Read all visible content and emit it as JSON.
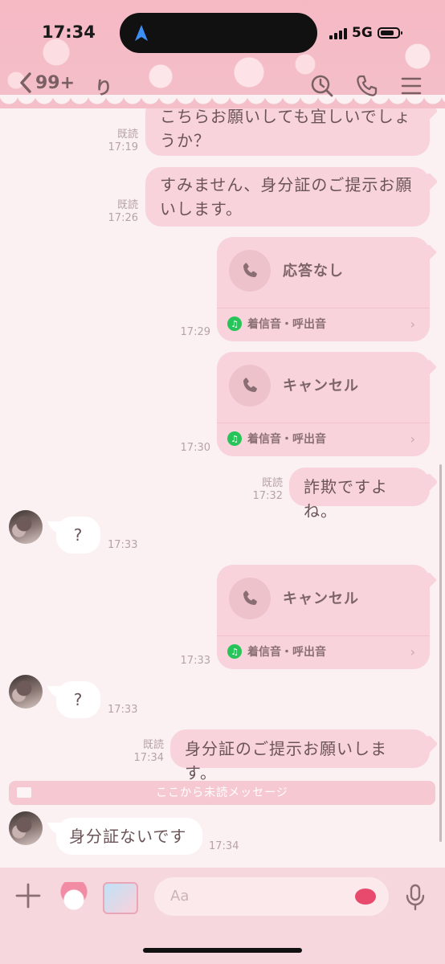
{
  "status_bar": {
    "time": "17:34",
    "network": "5G"
  },
  "header": {
    "back_count": "99+",
    "chat_name": "り"
  },
  "messages": [
    {
      "id": "m1",
      "side": "right",
      "text": "こちらお願いしても宜しいでしょうか？",
      "read": "既読",
      "time": "17:19"
    },
    {
      "id": "m2",
      "side": "right",
      "text": "すみません、身分証のご提示お願いします。",
      "read": "既読",
      "time": "17:26"
    },
    {
      "id": "m3",
      "side": "right",
      "type": "call",
      "title": "応答なし",
      "ringtone": "着信音・呼出音",
      "time": "17:29"
    },
    {
      "id": "m4",
      "side": "right",
      "type": "call",
      "title": "キャンセル",
      "ringtone": "着信音・呼出音",
      "time": "17:30"
    },
    {
      "id": "m5",
      "side": "right",
      "text": "詐欺ですよね。",
      "read": "既読",
      "time": "17:32"
    },
    {
      "id": "m6",
      "side": "left",
      "text": "?",
      "time": "17:33"
    },
    {
      "id": "m7",
      "side": "right",
      "type": "call",
      "title": "キャンセル",
      "ringtone": "着信音・呼出音",
      "time": "17:33"
    },
    {
      "id": "m8",
      "side": "left",
      "text": "?",
      "time": "17:33"
    },
    {
      "id": "m9",
      "side": "right",
      "text": "身分証のご提示お願いします。",
      "read": "既読",
      "time": "17:34"
    },
    {
      "id": "m10",
      "side": "left",
      "text": "身分証ないです",
      "time": "17:34"
    }
  ],
  "unread_divider": "ここから未読メッセージ",
  "composer": {
    "placeholder": "Aa"
  },
  "colors": {
    "bubble": "#f9d3dc",
    "header": "#f5b9c4",
    "background": "#fbf1f2",
    "ringtone_icon": "#27c45a"
  }
}
